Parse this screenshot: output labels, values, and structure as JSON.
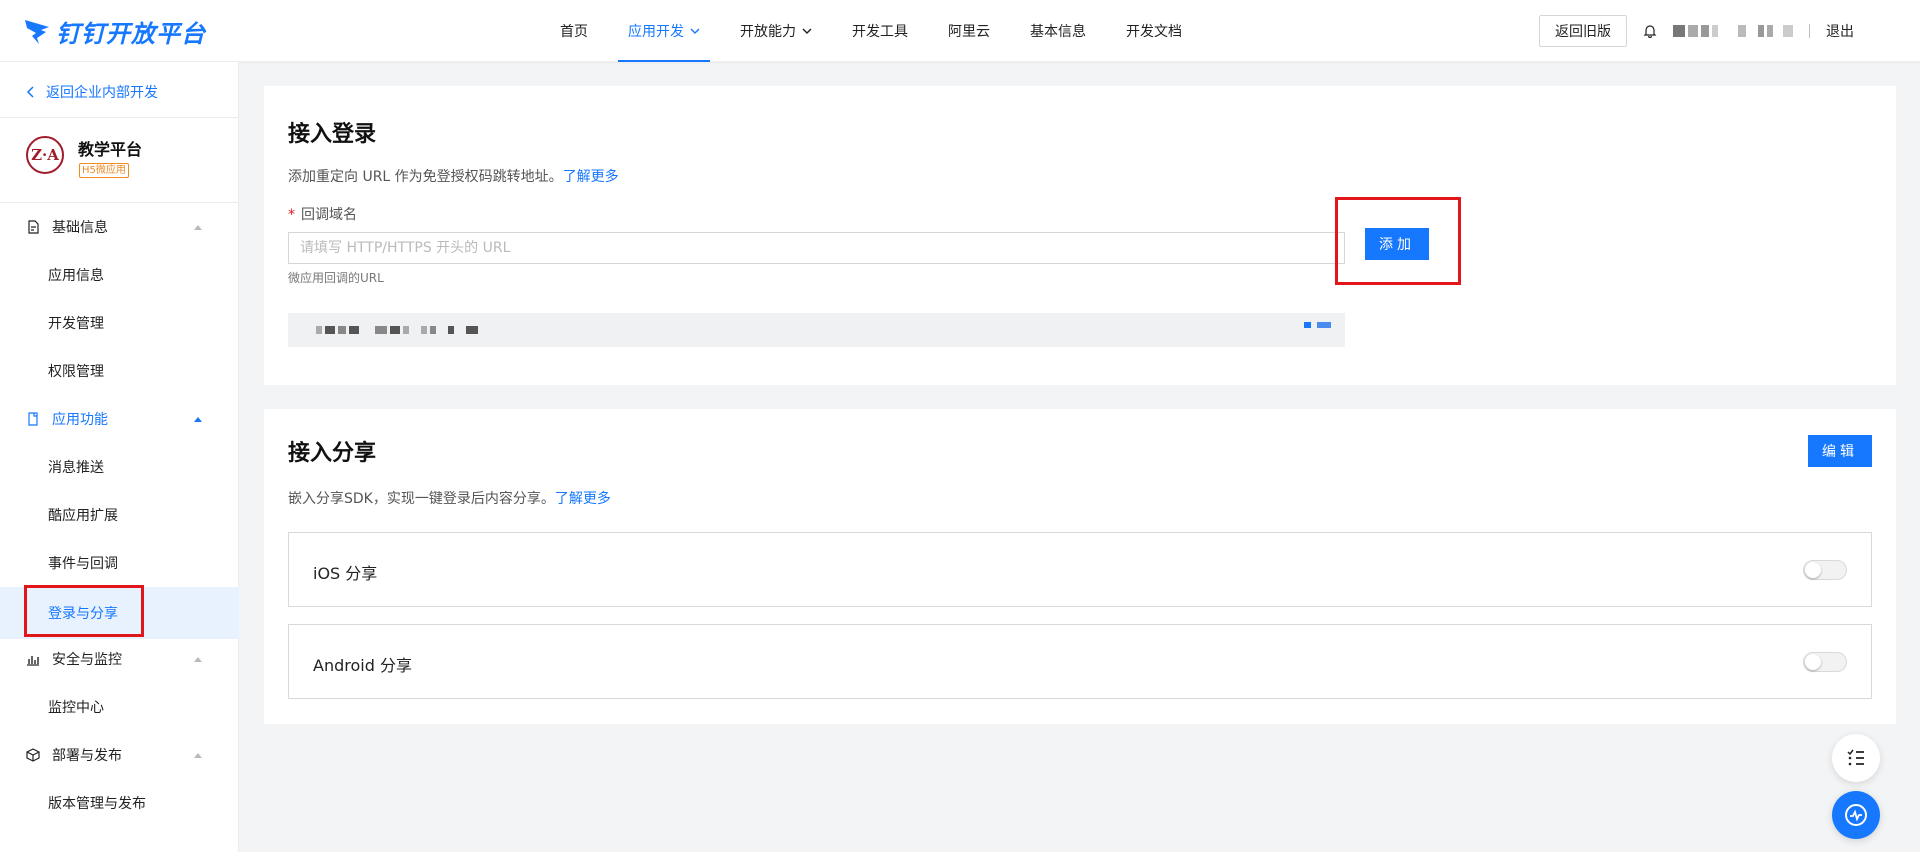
{
  "header": {
    "logo_text": "钉钉开放平台",
    "nav": [
      {
        "label": "首页"
      },
      {
        "label": "应用开发",
        "active": true
      },
      {
        "label": "开放能力"
      },
      {
        "label": "开发工具"
      },
      {
        "label": "阿里云"
      },
      {
        "label": "基本信息"
      },
      {
        "label": "开发文档"
      }
    ],
    "old_version_label": "返回旧版",
    "logout_label": "退出"
  },
  "sidebar": {
    "back_label": "返回企业内部开发",
    "app_avatar_text": "Z·A",
    "app_name": "教学平台",
    "app_badge": "H5微应用",
    "groups": [
      {
        "label": "基础信息",
        "icon": "document-icon",
        "items": [
          "应用信息",
          "开发管理",
          "权限管理"
        ]
      },
      {
        "label": "应用功能",
        "icon": "mobile-app-icon",
        "items": [
          "消息推送",
          "酷应用扩展",
          "事件与回调",
          "登录与分享"
        ]
      },
      {
        "label": "安全与监控",
        "icon": "bar-chart-icon",
        "items": [
          "监控中心"
        ]
      },
      {
        "label": "部署与发布",
        "icon": "cube-icon",
        "items": [
          "版本管理与发布"
        ]
      }
    ],
    "active_item": "登录与分享"
  },
  "login_card": {
    "title": "接入登录",
    "desc": "添加重定向 URL 作为免登授权码跳转地址。",
    "learn_more": "了解更多",
    "field_required_mark": "*",
    "field_label": "回调域名",
    "input_value": "",
    "input_placeholder": "请填写 HTTP/HTTPS 开头的 URL",
    "field_hint": "微应用回调的URL",
    "add_label": "添加"
  },
  "share_card": {
    "title": "接入分享",
    "desc": "嵌入分享SDK，实现一键登录后内容分享。",
    "learn_more": "了解更多",
    "edit_label": "编辑",
    "rows": [
      {
        "label": "iOS 分享",
        "enabled": false
      },
      {
        "label": "Android 分享",
        "enabled": false
      }
    ]
  },
  "colors": {
    "accent": "#1677ff",
    "highlight_box": "#e0161b",
    "badge": "#f08a24"
  }
}
